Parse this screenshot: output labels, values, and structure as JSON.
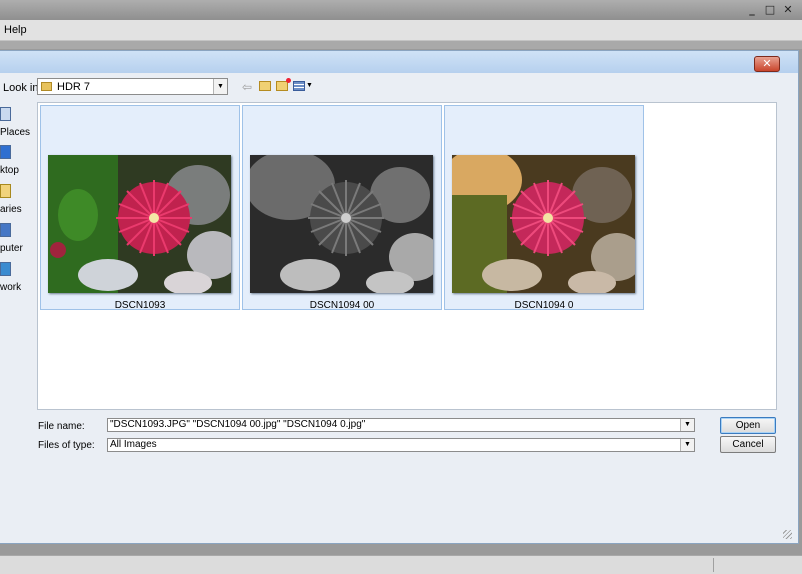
{
  "app": {
    "menu": [
      "Help"
    ],
    "window_controls": [
      "minimize-icon",
      "restore-icon",
      "close-icon"
    ]
  },
  "dialog": {
    "look_in_label": "Look in:",
    "look_in_value": "HDR 7",
    "toolbar_icons": [
      "back-arrow-icon",
      "up-folder-icon",
      "new-folder-icon",
      "view-menu-icon"
    ],
    "places": [
      {
        "label": "Places",
        "icon": "recent-places-icon"
      },
      {
        "label": "ktop",
        "icon": "desktop-icon"
      },
      {
        "label": "aries",
        "icon": "libraries-icon"
      },
      {
        "label": "puter",
        "icon": "computer-icon"
      },
      {
        "label": "work",
        "icon": "network-icon"
      }
    ],
    "files": [
      {
        "name": "DSCN1093"
      },
      {
        "name": "DSCN1094 00"
      },
      {
        "name": "DSCN1094 0"
      }
    ],
    "file_name_label": "File name:",
    "file_name_value": "\"DSCN1093.JPG\" \"DSCN1094 00.jpg\" \"DSCN1094 0.jpg\"",
    "file_type_label": "Files of type:",
    "file_type_value": "All Images",
    "open_label": "Open",
    "cancel_label": "Cancel"
  },
  "colors": {
    "dialog_title": "#c6dcf3",
    "selection_fill": "#e4eefb",
    "selection_border": "#9fc2e8",
    "close_button": "#c9452c"
  }
}
